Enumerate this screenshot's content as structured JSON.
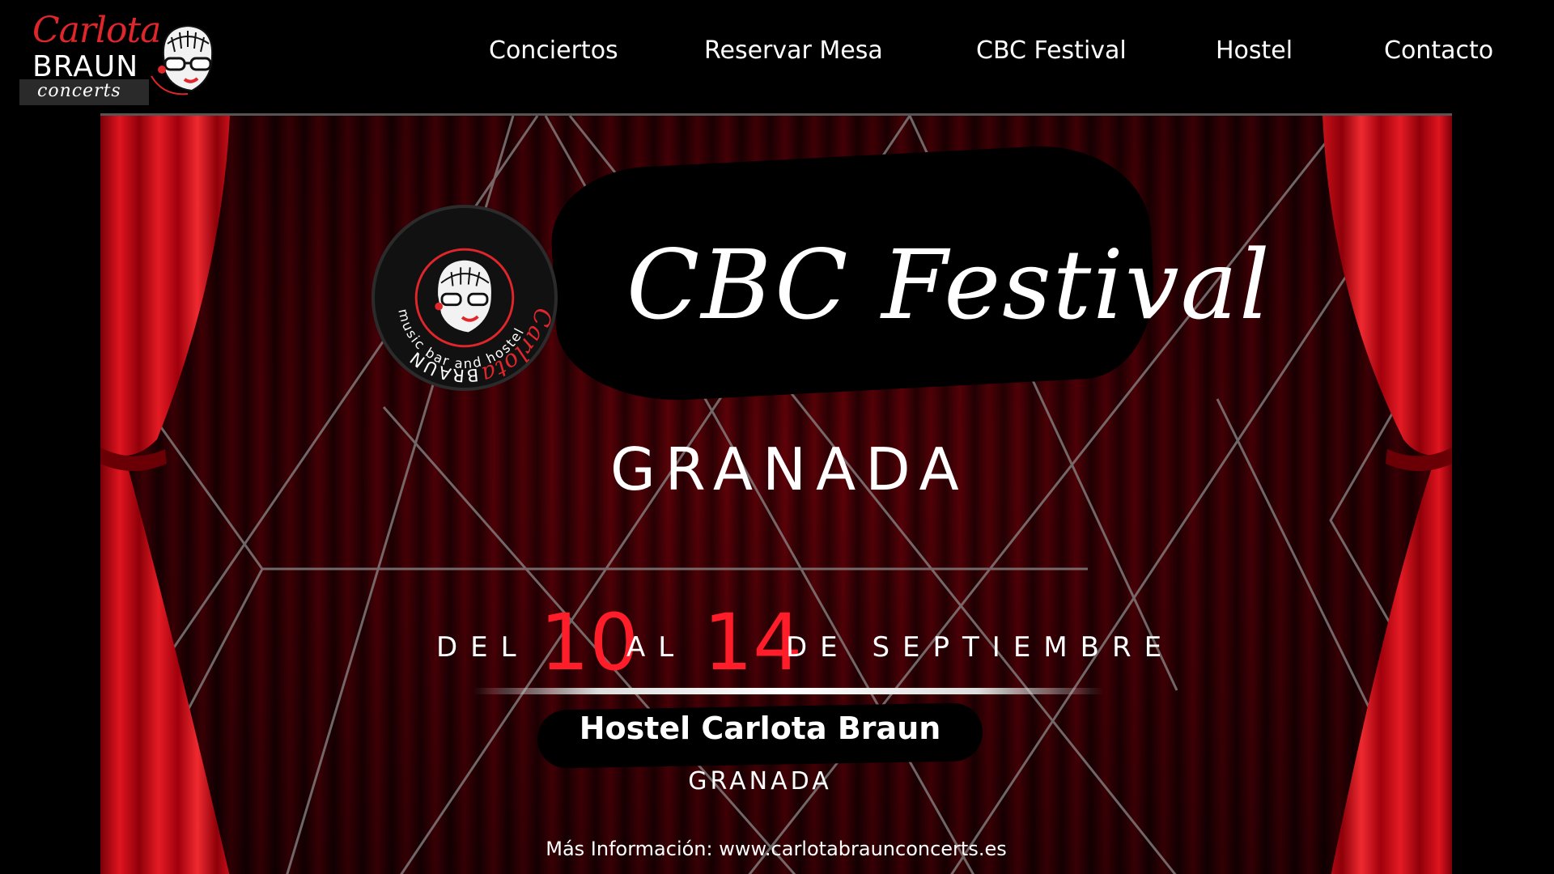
{
  "logo": {
    "script": "Carlota",
    "name": "BRAUN",
    "tagline": "concerts"
  },
  "nav": {
    "items": [
      {
        "label": "Conciertos"
      },
      {
        "label": "Reservar Mesa"
      },
      {
        "label": "CBC Festival"
      },
      {
        "label": "Hostel"
      },
      {
        "label": "Contacto"
      }
    ]
  },
  "banner": {
    "badge": {
      "script": "Carlota",
      "name": "BRAUN",
      "ring_text": "music bar and hostel"
    },
    "title": "CBC Festival",
    "city": "GRANADA",
    "dates": {
      "prefix": "DEL",
      "start": "10",
      "middle": "AL",
      "end": "14",
      "suffix": "DE SEPTIEMBRE"
    },
    "venue": "Hostel Carlota Braun",
    "venue_city": "GRANADA",
    "more_info": "Más Información: www.carlotabraunconcerts.es"
  },
  "colors": {
    "accent_red": "#ff1d2a",
    "logo_red": "#e0262b",
    "background": "#000000",
    "curtain_red": "#c8101a"
  },
  "icons": [
    "logo-face-icon",
    "badge-face-icon"
  ]
}
